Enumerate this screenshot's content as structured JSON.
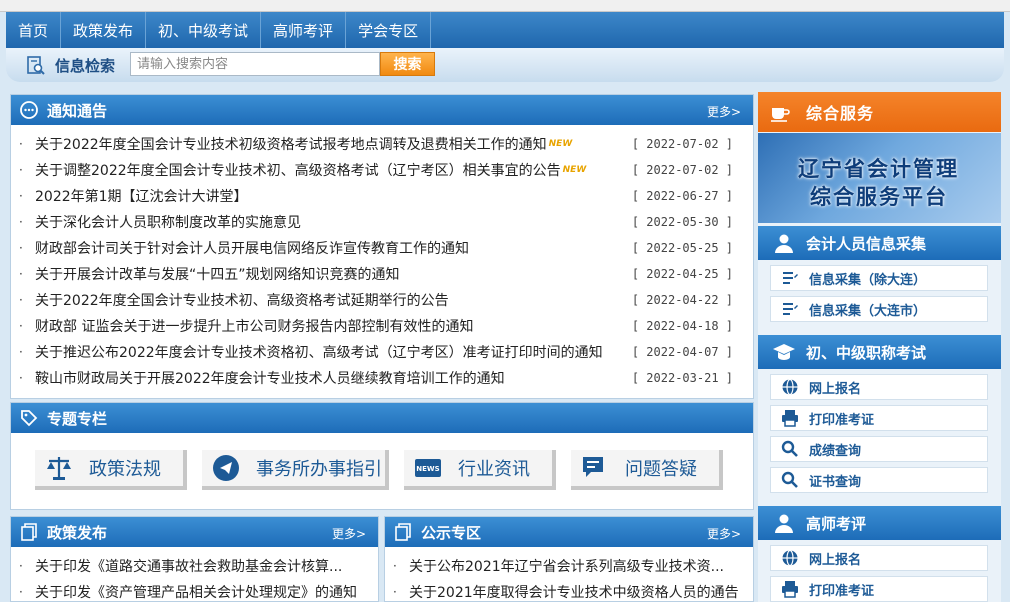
{
  "nav": {
    "items": [
      "首页",
      "政策发布",
      "初、中级考试",
      "高师考评",
      "学会专区"
    ]
  },
  "search": {
    "label": "信息检索",
    "placeholder": "请输入搜索内容",
    "button": "搜索"
  },
  "notices": {
    "title": "通知通告",
    "more": "更多>",
    "items": [
      {
        "text": "关于2022年度全国会计专业技术初级资格考试报考地点调转及退费相关工作的通知",
        "badge": "NEW",
        "date": "[ 2022-07-02 ]"
      },
      {
        "text": "关于调整2022年度全国会计专业技术初、高级资格考试（辽宁考区）相关事宜的公告",
        "badge": "NEW",
        "date": "[ 2022-07-02 ]"
      },
      {
        "text": "2022年第1期【辽沈会计大讲堂】",
        "badge": "",
        "date": "[ 2022-06-27 ]"
      },
      {
        "text": "关于深化会计人员职称制度改革的实施意见",
        "badge": "",
        "date": "[ 2022-05-30 ]"
      },
      {
        "text": "财政部会计司关于针对会计人员开展电信网络反诈宣传教育工作的通知",
        "badge": "",
        "date": "[ 2022-05-25 ]"
      },
      {
        "text": "关于开展会计改革与发展“十四五”规划网络知识竞赛的通知",
        "badge": "",
        "date": "[ 2022-04-25 ]"
      },
      {
        "text": "关于2022年度全国会计专业技术初、高级资格考试延期举行的公告",
        "badge": "",
        "date": "[ 2022-04-22 ]"
      },
      {
        "text": "财政部 证监会关于进一步提升上市公司财务报告内部控制有效性的通知",
        "badge": "",
        "date": "[ 2022-04-18 ]"
      },
      {
        "text": "关于推迟公布2022年度会计专业技术资格初、高级考试（辽宁考区）准考证打印时间的通知",
        "badge": "",
        "date": "[ 2022-04-07 ]"
      },
      {
        "text": "鞍山市财政局关于开展2022年度会计专业技术人员继续教育培训工作的通知",
        "badge": "",
        "date": "[ 2022-03-21 ]"
      }
    ]
  },
  "topics": {
    "title": "专题专栏",
    "items": [
      "政策法规",
      "事务所办事指引",
      "行业资讯",
      "问题答疑"
    ],
    "news_icon_text": "NEWS"
  },
  "policy": {
    "title": "政策发布",
    "more": "更多>",
    "items": [
      "关于印发《道路交通事故社会救助基金会计核算...",
      "关于印发《资产管理产品相关会计处理规定》的通知"
    ]
  },
  "public": {
    "title": "公示专区",
    "more": "更多>",
    "items": [
      "关于公布2021年辽宁省会计系列高级专业技术资...",
      "关于2021年度取得会计专业技术中级资格人员的通告"
    ]
  },
  "services": {
    "title": "综合服务",
    "banner_line1": "辽宁省会计管理",
    "banner_line2": "综合服务平台",
    "sections": [
      {
        "title": "会计人员信息采集",
        "items": [
          "信息采集（除大连）",
          "信息采集（大连市）"
        ]
      },
      {
        "title": "初、中级职称考试",
        "items": [
          "网上报名",
          "打印准考证",
          "成绩查询",
          "证书查询"
        ]
      },
      {
        "title": "高师考评",
        "items": [
          "网上报名",
          "打印准考证"
        ]
      }
    ]
  },
  "colors": {
    "nav_blue": "#1f67ad",
    "accent_orange": "#f18a10",
    "link_blue": "#1d5a96"
  }
}
